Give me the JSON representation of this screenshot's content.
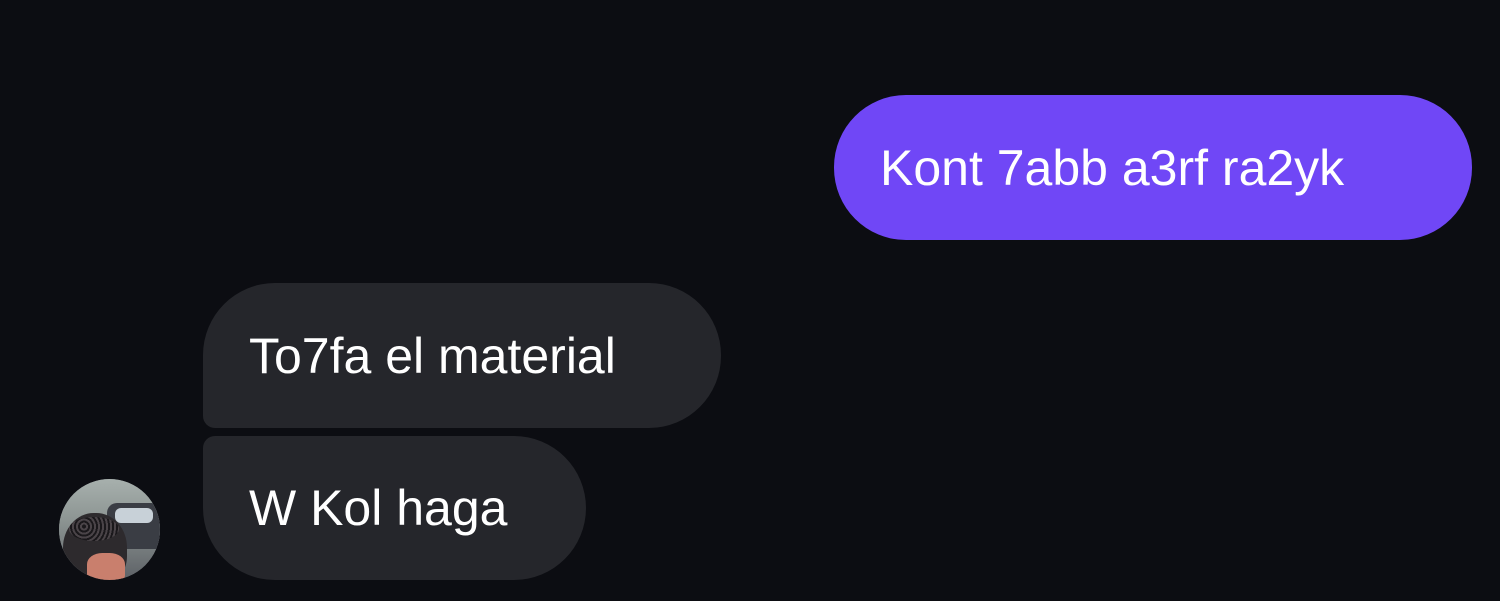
{
  "messages": [
    {
      "direction": "outgoing",
      "text": "Kont 7abb a3rf ra2yk"
    },
    {
      "direction": "incoming",
      "text": "To7fa el material"
    },
    {
      "direction": "incoming",
      "text": "W Kol haga"
    }
  ],
  "colors": {
    "background": "#0c0d12",
    "outgoing_bubble": "#7047f6",
    "incoming_bubble": "#25262b",
    "text": "#ffffff"
  },
  "avatar": {
    "icon": "contact-avatar-photo"
  }
}
